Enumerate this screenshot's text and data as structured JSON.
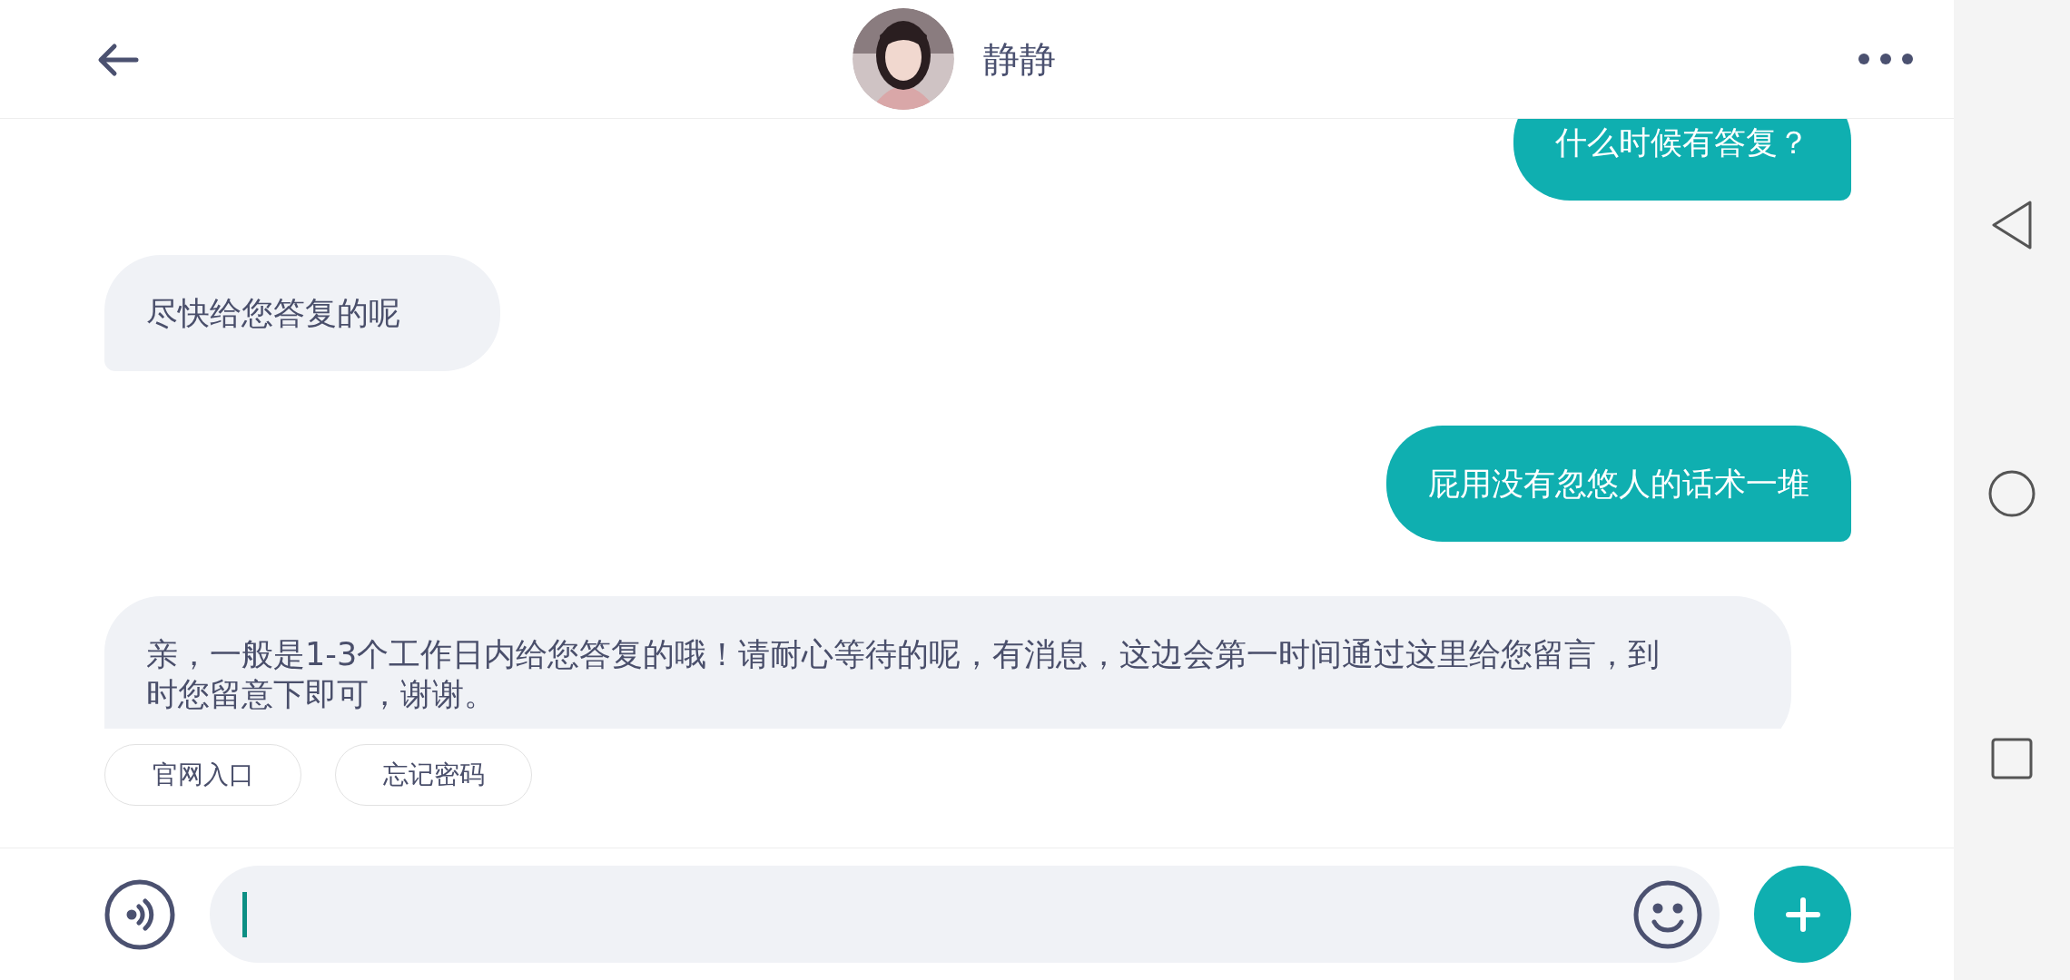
{
  "header": {
    "title": "静静"
  },
  "messages": [
    {
      "kind": "sent",
      "text": "什么时候有答复？"
    },
    {
      "kind": "received",
      "text": "尽快给您答复的呢"
    },
    {
      "kind": "sent",
      "text": "屁用没有忽悠人的话术一堆"
    },
    {
      "kind": "received",
      "text": "亲，一般是1-3个工作日内给您答复的哦！请耐心等待的呢，有消息，这边会第一时间通过这里给您留言，到时您留意下即可，谢谢。"
    }
  ],
  "quick_replies": [
    "官网入口",
    "忘记密码"
  ]
}
